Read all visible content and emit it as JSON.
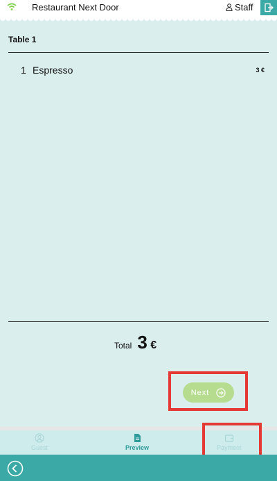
{
  "header": {
    "title": "Restaurant Next Door",
    "staff_label": "Staff"
  },
  "order": {
    "table_label": "Table 1",
    "items": [
      {
        "qty": "1",
        "name": "Espresso",
        "price": "3 €"
      }
    ],
    "total_label": "Total",
    "total_value": "3",
    "total_currency": "€"
  },
  "actions": {
    "next_label": "Next"
  },
  "tabs": [
    {
      "label": "Guest",
      "state": "disabled"
    },
    {
      "label": "Preview",
      "state": "active"
    },
    {
      "label": "Payment",
      "state": "disabled"
    }
  ],
  "colors": {
    "background": "#dbeeee",
    "accent": "#3ba9a6",
    "next_button": "#b6dc8f",
    "highlight": "#e53935"
  }
}
